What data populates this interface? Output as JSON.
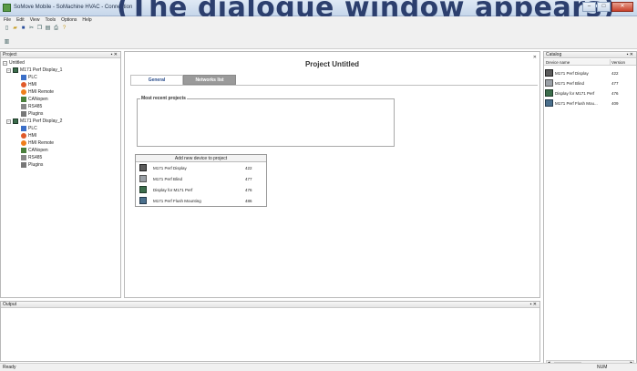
{
  "window": {
    "title": "SoMove Mobile - SoMachine HVAC - Connection",
    "overlay_caption": "(The dialogue window appears)",
    "buttons": {
      "minimize": "–",
      "maximize": "□",
      "close": "✕"
    }
  },
  "menu": [
    "File",
    "Edit",
    "View",
    "Tools",
    "Options",
    "Help"
  ],
  "toolbar": [
    "new-icon",
    "open-icon",
    "save-icon",
    "cut-icon",
    "copy-icon",
    "paste-icon",
    "print-icon",
    "help-icon"
  ],
  "project_panel": {
    "title": "Project",
    "pin": "▪ ✕",
    "root": "Untitled",
    "devices": [
      {
        "name": "M171 Perf Display_1",
        "children": [
          "PLC",
          "HMI",
          "HMI Remote",
          "CANopen",
          "RS485",
          "Plugins"
        ]
      },
      {
        "name": "M171 Perf Display_2",
        "children": [
          "PLC",
          "HMI",
          "HMI Remote",
          "CANopen",
          "RS485",
          "Plugins"
        ]
      }
    ]
  },
  "main": {
    "close": "✕",
    "title": "Project Untitled",
    "tabs": [
      "General",
      "Networks list"
    ],
    "recent_label": "Most recent projects",
    "add_device": {
      "header": "Add new device to project",
      "rows": [
        {
          "name": "M171 Perf Display",
          "version": "422"
        },
        {
          "name": "M171 Perf Blind",
          "version": "477"
        },
        {
          "name": "Display for M171 Perf",
          "version": "476"
        },
        {
          "name": "M171 Perf Flush Mounting",
          "version": "486"
        }
      ]
    }
  },
  "catalog": {
    "title": "Catalog",
    "pin": "▪ ✕",
    "columns": [
      "Device name",
      "Version"
    ],
    "rows": [
      {
        "name": "M171 Perf Display",
        "version": "422"
      },
      {
        "name": "M171 Perf Blind",
        "version": "477"
      },
      {
        "name": "Display for M171 Perf",
        "version": "476"
      },
      {
        "name": "M171 Perf Flush Mou...",
        "version": "409"
      }
    ]
  },
  "output_panel": {
    "title": "Output",
    "pin": "▪ ✕"
  },
  "status": {
    "left": "Ready",
    "right": "NUM"
  }
}
